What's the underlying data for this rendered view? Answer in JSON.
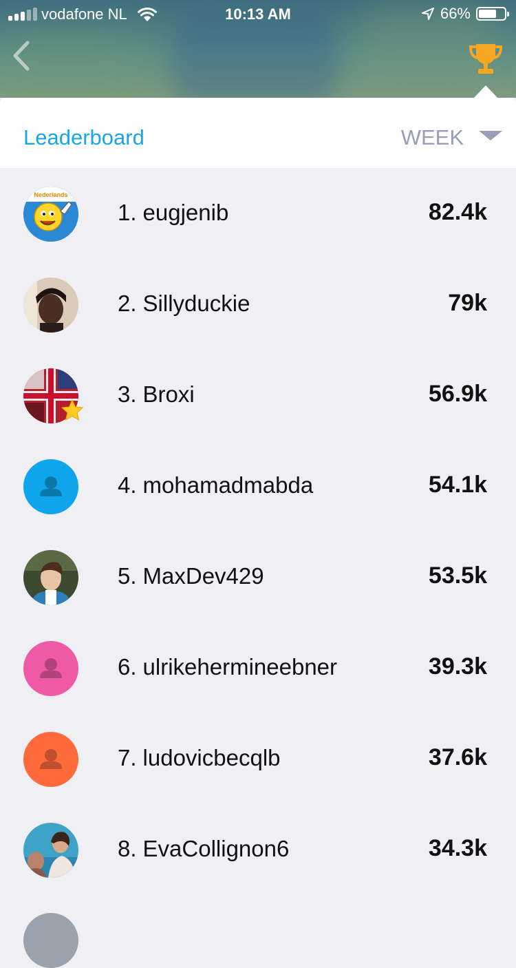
{
  "status_bar": {
    "carrier": "vodafone NL",
    "time": "10:13 AM",
    "battery": "66%",
    "battery_level": 0.66,
    "icons": [
      "signal-icon",
      "wifi-icon",
      "location-arrow-icon",
      "battery-icon"
    ]
  },
  "header": {
    "title": "Leaderboard",
    "period": "WEEK",
    "back_icon": "chevron-left-icon",
    "trophy_icon": "trophy-icon"
  },
  "colors": {
    "title": "#1aa7e0",
    "period": "#9a9cb8",
    "list_bg": "#efeff4",
    "trophy": "#f5a623"
  },
  "leaderboard": [
    {
      "rank": "1.",
      "name": "eugjenib",
      "score": "82.4k",
      "avatar": "photo"
    },
    {
      "rank": "2.",
      "name": "Sillyduckie",
      "score": "79k",
      "avatar": "photo"
    },
    {
      "rank": "3.",
      "name": "Broxi",
      "score": "56.9k",
      "avatar": "photo",
      "badge": "star-icon"
    },
    {
      "rank": "4.",
      "name": "mohamadmabda",
      "score": "54.1k",
      "avatar": "default",
      "avatar_color": "#0ea5ea"
    },
    {
      "rank": "5.",
      "name": "MaxDev429",
      "score": "53.5k",
      "avatar": "photo"
    },
    {
      "rank": "6.",
      "name": "ulrikehermineebner",
      "score": "39.3k",
      "avatar": "default",
      "avatar_color": "#ee5aa6"
    },
    {
      "rank": "7.",
      "name": "ludovicbecqlb",
      "score": "37.6k",
      "avatar": "default",
      "avatar_color": "#ff6a3d"
    },
    {
      "rank": "8.",
      "name": "EvaCollignon6",
      "score": "34.3k",
      "avatar": "photo"
    }
  ]
}
